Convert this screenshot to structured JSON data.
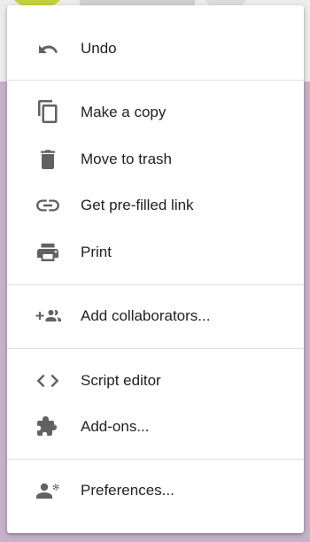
{
  "colors": {
    "icon": "#616161",
    "text": "#212121",
    "divider": "#e0e0e0",
    "menu_background": "#ffffff"
  },
  "menu": {
    "items": [
      {
        "label": "Undo",
        "icon": "undo-icon"
      },
      {
        "label": "Make a copy",
        "icon": "copy-icon"
      },
      {
        "label": "Move to trash",
        "icon": "trash-icon"
      },
      {
        "label": "Get pre-filled link",
        "icon": "link-icon"
      },
      {
        "label": "Print",
        "icon": "print-icon"
      },
      {
        "label": "Add collaborators...",
        "icon": "add-people-icon"
      },
      {
        "label": "Script editor",
        "icon": "code-icon"
      },
      {
        "label": "Add-ons...",
        "icon": "puzzle-icon"
      },
      {
        "label": "Preferences...",
        "icon": "person-settings-icon"
      }
    ]
  }
}
